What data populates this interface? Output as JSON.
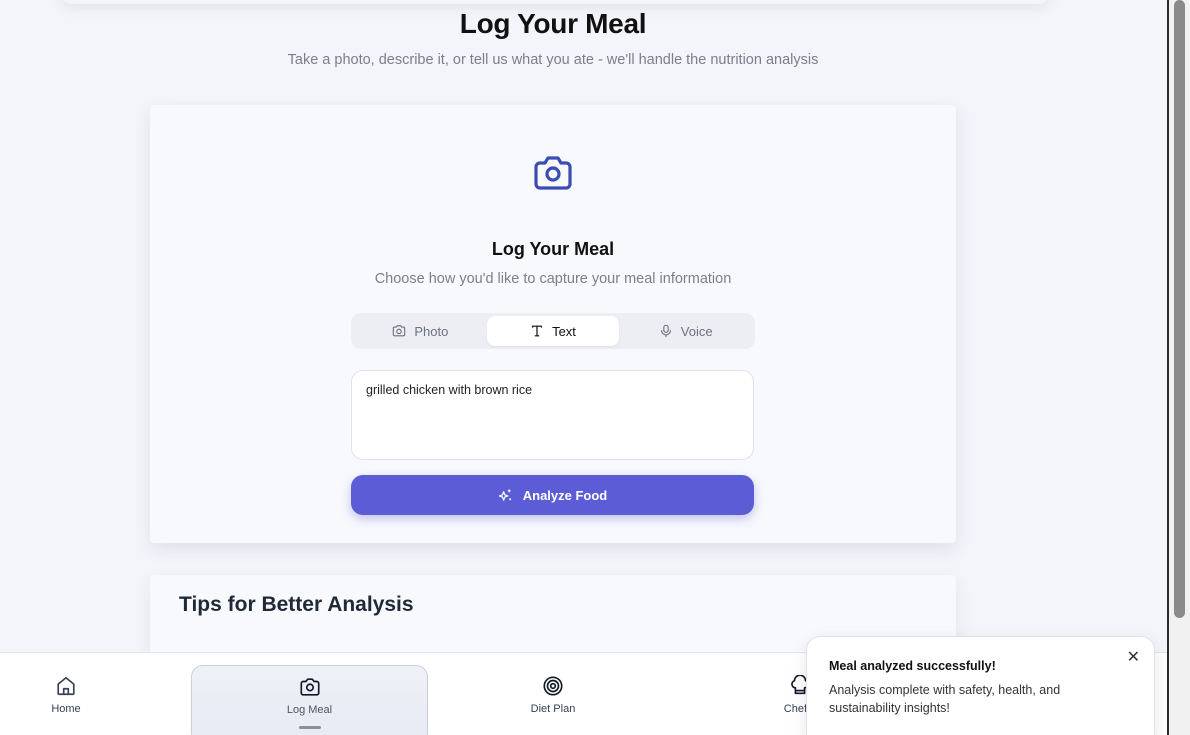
{
  "header": {
    "title": "Log Your Meal",
    "subtitle": "Take a photo, describe it, or tell us what you ate - we'll handle the nutrition analysis"
  },
  "card": {
    "title": "Log Your Meal",
    "subtitle": "Choose how you'd like to capture your meal information",
    "tabs": [
      {
        "label": "Photo",
        "icon": "camera-icon",
        "active": false
      },
      {
        "label": "Text",
        "icon": "text-icon",
        "active": true
      },
      {
        "label": "Voice",
        "icon": "microphone-icon",
        "active": false
      }
    ],
    "input_value": "grilled chicken with brown rice",
    "analyze_label": "Analyze Food"
  },
  "tips": {
    "title": "Tips for Better Analysis"
  },
  "nav": {
    "items": [
      {
        "label": "Home",
        "icon": "home-icon"
      },
      {
        "label": "Log Meal",
        "icon": "camera-icon",
        "active": true
      },
      {
        "label": "Diet Plan",
        "icon": "target-icon"
      },
      {
        "label": "Chef...",
        "icon": "chef-icon"
      }
    ]
  },
  "toast": {
    "title": "Meal analyzed successfully!",
    "message": "Analysis complete with safety, health, and sustainability insights!"
  },
  "colors": {
    "accent": "#5b5cd6",
    "icon_blue": "#3b4db3",
    "background": "#f4f5fb"
  }
}
